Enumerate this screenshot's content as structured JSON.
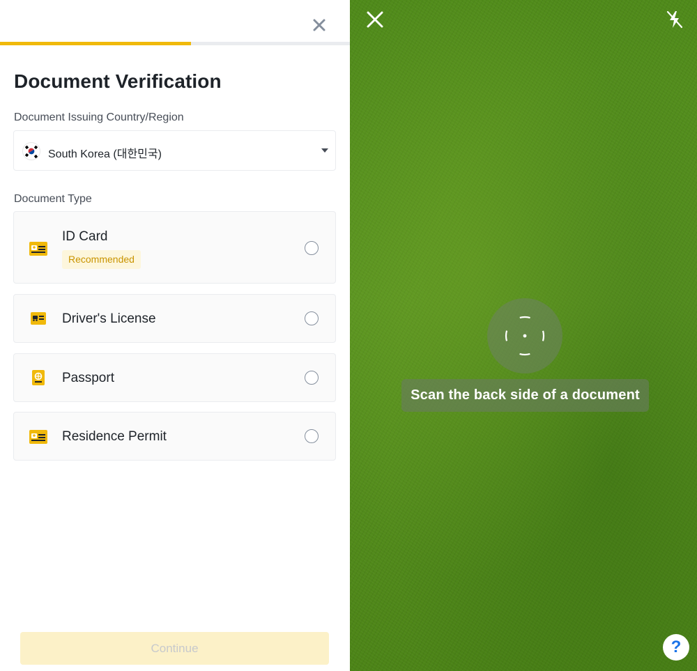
{
  "verification_panel": {
    "close_icon": "close-icon",
    "progress_fraction": 0.545,
    "title": "Document Verification",
    "country_label": "Document Issuing Country/Region",
    "country_select": {
      "value": "South Korea (대한민국)",
      "flag_icon": "south-korea-flag-icon",
      "caret_icon": "caret-down-icon"
    },
    "document_type_label": "Document Type",
    "document_types": [
      {
        "label": "ID Card",
        "badge": "Recommended",
        "icon": "id-card-icon",
        "selected": false
      },
      {
        "label": "Driver's License",
        "icon": "driver-license-icon",
        "selected": false
      },
      {
        "label": "Passport",
        "icon": "passport-icon",
        "selected": false
      },
      {
        "label": "Residence Permit",
        "icon": "residence-permit-icon",
        "selected": false
      }
    ],
    "continue_label": "Continue",
    "continue_enabled": false
  },
  "camera_panel": {
    "close_icon": "close-icon",
    "flash_icon": "flash-off-icon",
    "focus_icon": "focus-target-icon",
    "scan_hint": "Scan the back side of a document",
    "help_label": "?"
  },
  "colors": {
    "accent": "#f0b90b",
    "badge_text": "#c99400",
    "badge_bg": "#fdf6dc",
    "continue_disabled_bg": "#fcf1c8",
    "help_glyph": "#1a73e8",
    "camera_green": "#5a9421"
  }
}
